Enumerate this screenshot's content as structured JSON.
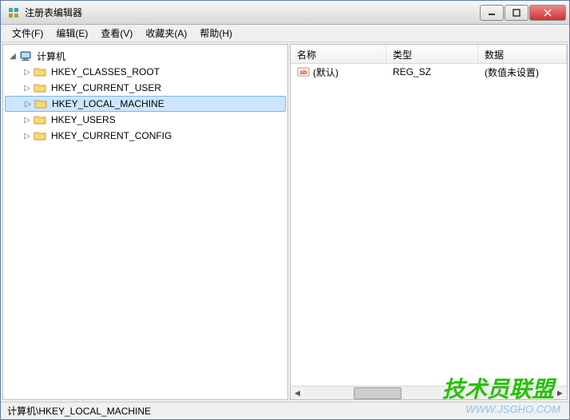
{
  "window": {
    "title": "注册表编辑器"
  },
  "menu": {
    "file": "文件(F)",
    "edit": "编辑(E)",
    "view": "查看(V)",
    "favorites": "收藏夹(A)",
    "help": "帮助(H)"
  },
  "tree": {
    "root": "计算机",
    "nodes": [
      {
        "label": "HKEY_CLASSES_ROOT",
        "selected": false
      },
      {
        "label": "HKEY_CURRENT_USER",
        "selected": false
      },
      {
        "label": "HKEY_LOCAL_MACHINE",
        "selected": true
      },
      {
        "label": "HKEY_USERS",
        "selected": false
      },
      {
        "label": "HKEY_CURRENT_CONFIG",
        "selected": false
      }
    ]
  },
  "list": {
    "columns": {
      "name": "名称",
      "type": "类型",
      "data": "数据"
    },
    "rows": [
      {
        "name": "(默认)",
        "type": "REG_SZ",
        "data": "(数值未设置)"
      }
    ]
  },
  "statusbar": {
    "path": "计算机\\HKEY_LOCAL_MACHINE"
  },
  "watermark": {
    "brand": "技术员联盟",
    "url": "WWW.JSGHO.COM"
  }
}
